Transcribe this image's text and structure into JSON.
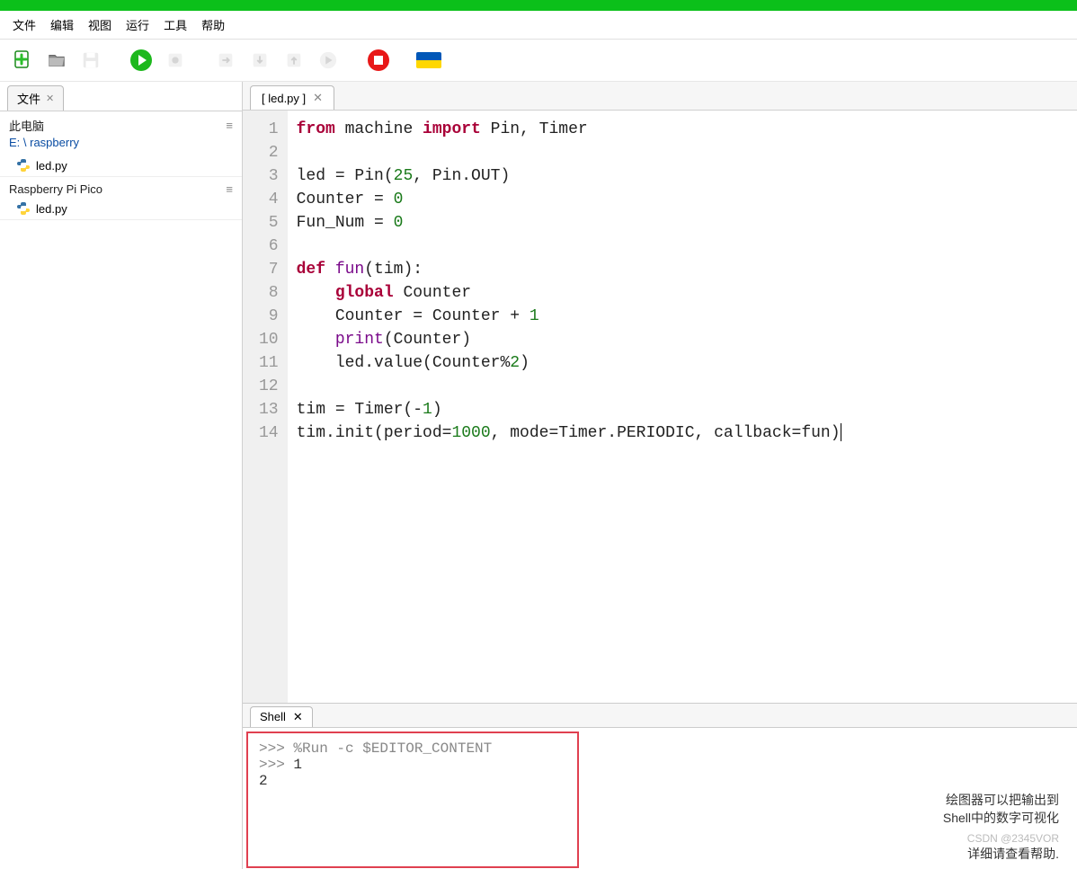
{
  "menu": {
    "file": "文件",
    "edit": "编辑",
    "view": "视图",
    "run": "运行",
    "tools": "工具",
    "help": "帮助"
  },
  "sidebar": {
    "tab": "文件",
    "groups": [
      {
        "title": "此电脑",
        "path_prefix": "E: \\ ",
        "path_link": "raspberry",
        "items": [
          {
            "name": "led.py"
          }
        ]
      },
      {
        "title": "Raspberry Pi Pico",
        "items": [
          {
            "name": "led.py"
          }
        ]
      }
    ]
  },
  "editor": {
    "tab": "[ led.py ]",
    "lines": [
      {
        "n": "1",
        "segs": [
          {
            "t": "from",
            "c": "kw"
          },
          {
            "t": " machine "
          },
          {
            "t": "import",
            "c": "kw"
          },
          {
            "t": " Pin, Timer"
          }
        ]
      },
      {
        "n": "2",
        "segs": []
      },
      {
        "n": "3",
        "segs": [
          {
            "t": "led = Pin("
          },
          {
            "t": "25",
            "c": "num"
          },
          {
            "t": ", Pin.OUT)"
          }
        ]
      },
      {
        "n": "4",
        "segs": [
          {
            "t": "Counter = "
          },
          {
            "t": "0",
            "c": "num"
          }
        ]
      },
      {
        "n": "5",
        "segs": [
          {
            "t": "Fun_Num = "
          },
          {
            "t": "0",
            "c": "num"
          }
        ]
      },
      {
        "n": "6",
        "segs": []
      },
      {
        "n": "7",
        "segs": [
          {
            "t": "def ",
            "c": "kw"
          },
          {
            "t": "fun",
            "c": "fn"
          },
          {
            "t": "(tim):"
          }
        ]
      },
      {
        "n": "8",
        "segs": [
          {
            "t": "    "
          },
          {
            "t": "global",
            "c": "kw"
          },
          {
            "t": " Counter"
          }
        ]
      },
      {
        "n": "9",
        "segs": [
          {
            "t": "    Counter = Counter + "
          },
          {
            "t": "1",
            "c": "num"
          }
        ]
      },
      {
        "n": "10",
        "segs": [
          {
            "t": "    "
          },
          {
            "t": "print",
            "c": "fn"
          },
          {
            "t": "(Counter)"
          }
        ]
      },
      {
        "n": "11",
        "segs": [
          {
            "t": "    led.value(Counter%"
          },
          {
            "t": "2",
            "c": "num"
          },
          {
            "t": ")"
          }
        ]
      },
      {
        "n": "12",
        "segs": []
      },
      {
        "n": "13",
        "segs": [
          {
            "t": "tim = Timer(-"
          },
          {
            "t": "1",
            "c": "num"
          },
          {
            "t": ")"
          }
        ]
      },
      {
        "n": "14",
        "segs": [
          {
            "t": "tim.init(period="
          },
          {
            "t": "1000",
            "c": "num"
          },
          {
            "t": ", mode=Timer.PERIODIC, callback=fun)"
          }
        ],
        "cursor": true
      }
    ]
  },
  "shell": {
    "tab": "Shell",
    "lines": [
      {
        "prompt": ">>> ",
        "text": "%Run -c $EDITOR_CONTENT",
        "cls": "cmd"
      },
      {
        "prompt": "",
        "text": "",
        "cls": "out"
      },
      {
        "prompt": ">>> ",
        "text": "1",
        "cls": "out"
      },
      {
        "prompt": "  ",
        "text": "2",
        "cls": "out"
      }
    ]
  },
  "info": {
    "l1": "绘图器可以把输出到",
    "l2": "Shell中的数字可视化",
    "l3": "详细请查看帮助.",
    "watermark": "CSDN @2345VOR"
  }
}
